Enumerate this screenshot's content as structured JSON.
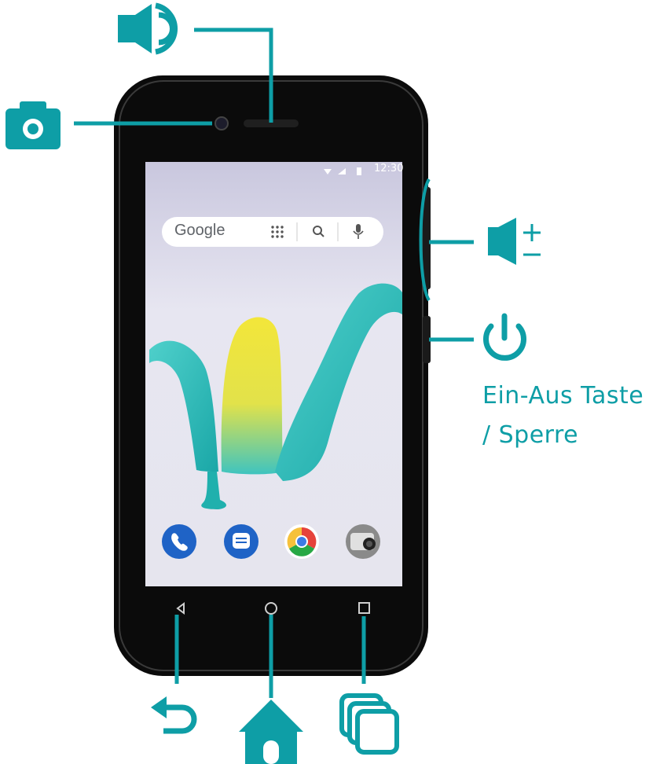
{
  "brand_color": "#0e9ea6",
  "phone": {
    "status_time": "12:30",
    "search_bar": {
      "logo_text": "Google"
    },
    "dock_apps": [
      "phone-icon",
      "messages-icon",
      "chrome-icon",
      "camera-icon"
    ],
    "nav_buttons": [
      "back-button",
      "home-button",
      "recents-button"
    ]
  },
  "callouts": {
    "power_label_line1": "Ein-Aus Taste",
    "power_label_line2": "/ Sperre"
  },
  "icons": [
    "speaker-icon",
    "camera-icon",
    "volume-icon",
    "power-icon",
    "back-icon",
    "home-icon",
    "recents-icon"
  ]
}
